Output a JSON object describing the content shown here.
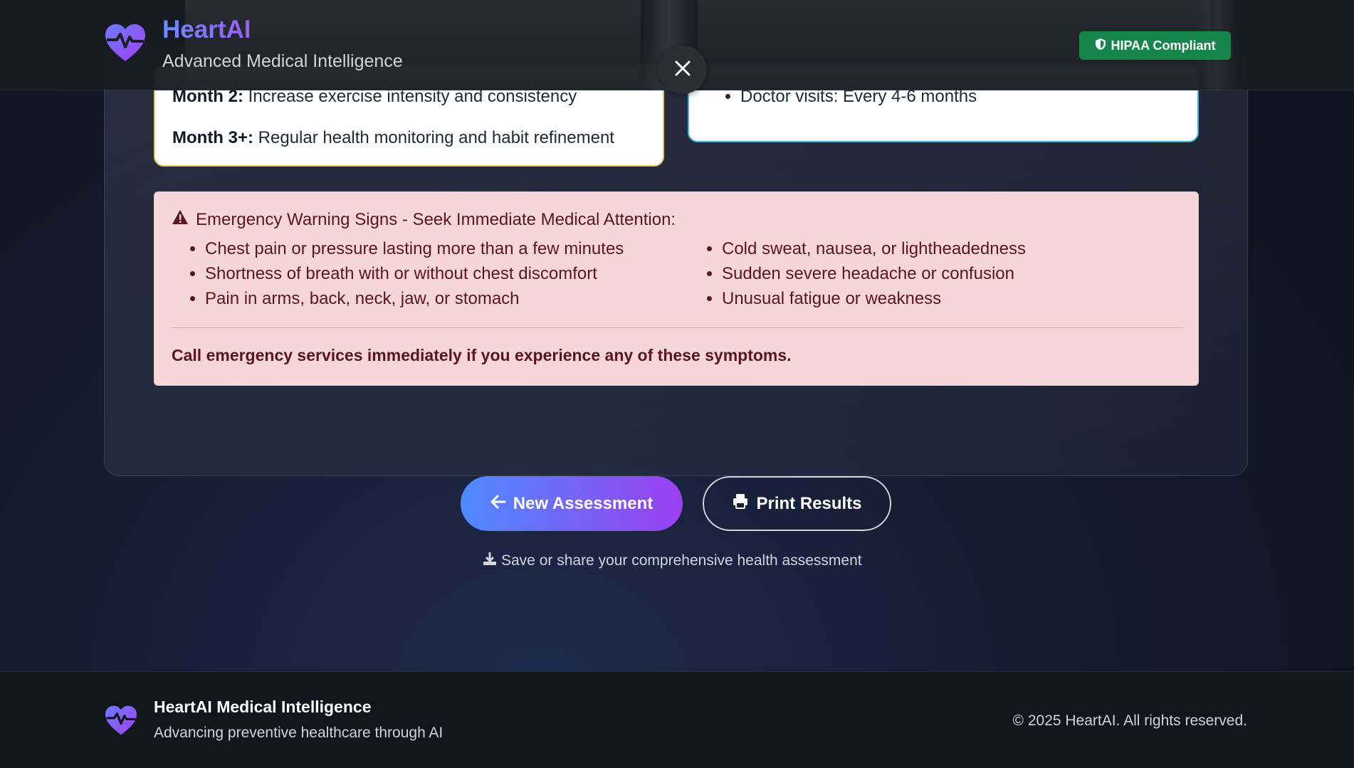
{
  "header": {
    "title": "HeartAI",
    "subtitle": "Advanced Medical Intelligence",
    "badge": "HIPAA Compliant",
    "logo_icon": "heart-pulse-icon"
  },
  "plan": {
    "month2_label": "Month 2:",
    "month2_text": " Increase exercise intensity and consistency",
    "month3_label": "Month 3+:",
    "month3_text": " Regular health monitoring and habit refinement"
  },
  "followup": {
    "items": [
      "Doctor visits: Every 4-6 months"
    ]
  },
  "warning": {
    "title": "Emergency Warning Signs - Seek Immediate Medical Attention:",
    "col1": [
      "Chest pain or pressure lasting more than a few minutes",
      "Shortness of breath with or without chest discomfort",
      "Pain in arms, back, neck, jaw, or stomach"
    ],
    "col2": [
      "Cold sweat, nausea, or lightheadedness",
      "Sudden severe headache or confusion",
      "Unusual fatigue or weakness"
    ],
    "call": "Call emergency services immediately if you experience any of these symptoms."
  },
  "actions": {
    "new_assessment": "New Assessment",
    "print_results": "Print Results",
    "save_note": "Save or share your comprehensive health assessment"
  },
  "footer": {
    "title": "HeartAI Medical Intelligence",
    "subtitle": "Advancing preventive healthcare through AI",
    "copyright": "© 2025 HeartAI. All rights reserved."
  },
  "colors": {
    "brand_gradient_start": "#4d8bff",
    "brand_gradient_end": "#9a3ff0",
    "hipaa_green": "#16864d",
    "warning_bg": "#f7d6da",
    "warning_text": "#5b1420"
  }
}
